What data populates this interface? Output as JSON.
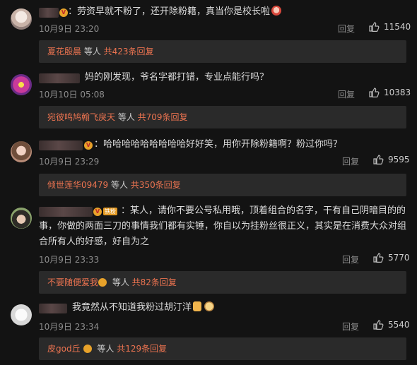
{
  "actions": {
    "reply_label": "回复"
  },
  "comments": [
    {
      "text": "：劳资早就不粉了，还开除粉籍，真当你是校长啦",
      "time": "10月9日 23:20",
      "likes": "11540",
      "reply_summary": {
        "user": "夏花殷晨",
        "middle": " 等人 ",
        "count_text": "共423条回复"
      }
    },
    {
      "text": "妈的刚发现，爷名字都打错，专业点能行吗？",
      "time": "10月10日 05:08",
      "likes": "10383",
      "reply_summary": {
        "user": "宛彼鸣鸠翰飞戾天",
        "middle": " 等人 ",
        "count_text": "共709条回复"
      }
    },
    {
      "text": "：哈哈哈哈哈哈哈哈哈好好笑，用你开除粉籍啊？粉过你吗？",
      "time": "10月9日 23:29",
      "likes": "9595",
      "reply_summary": {
        "user": "倾世莲华09479",
        "middle": " 等人 ",
        "count_text": "共350条回复"
      }
    },
    {
      "badge": "铁粉",
      "text": "：某人，请你不要公号私用哦，顶着组合的名字，干有自己阴暗目的的事，你做的两面三刀的事情我们都有实锤，你自以为挂粉丝很正义，其实是在消费大众对组合所有人的好感，好自为之",
      "time": "10月9日 23:33",
      "likes": "5770",
      "reply_summary": {
        "user": "不要随便爱我",
        "middle": " 等人 ",
        "count_text": "共82条回复"
      }
    },
    {
      "text": "我竟然从不知道我粉过胡汀洋",
      "time": "10月9日 23:34",
      "likes": "5540",
      "reply_summary": {
        "user": "皮god丘",
        "middle": " 等人 ",
        "count_text": "共129条回复"
      }
    }
  ]
}
